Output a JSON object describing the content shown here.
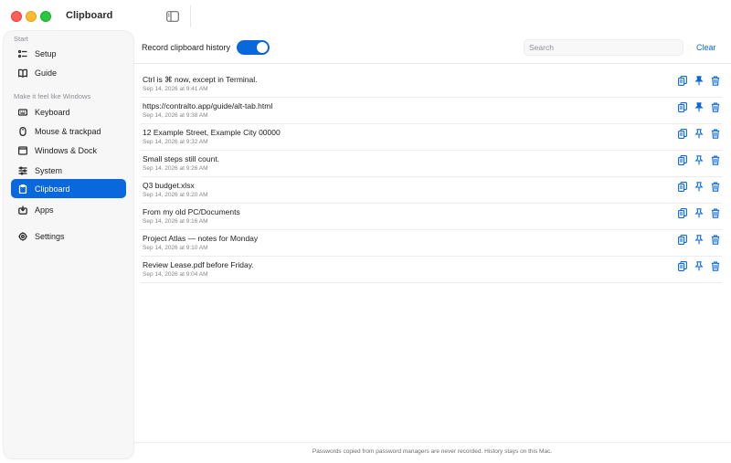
{
  "window": {
    "title": "Clipboard"
  },
  "sidebar": {
    "section_start": "Start",
    "section_windows": "Make it feel like Windows",
    "items": [
      {
        "label": "Setup",
        "icon": "checklist-icon"
      },
      {
        "label": "Guide",
        "icon": "book-icon"
      },
      {
        "label": "Keyboard",
        "icon": "keyboard-icon"
      },
      {
        "label": "Mouse & trackpad",
        "icon": "mouse-icon"
      },
      {
        "label": "Windows & Dock",
        "icon": "windows-icon"
      },
      {
        "label": "System",
        "icon": "sliders-icon"
      },
      {
        "label": "Clipboard",
        "icon": "clipboard-icon",
        "active": true
      },
      {
        "label": "Apps",
        "icon": "apps-icon"
      },
      {
        "label": "Settings",
        "icon": "gear-icon"
      }
    ]
  },
  "toolbar": {
    "record_label": "Record clipboard history",
    "record_enabled": true,
    "search_placeholder": "Search",
    "clear_label": "Clear"
  },
  "clips": [
    {
      "text": "Ctrl is ⌘ now, except in Terminal.",
      "time": "Sep 14, 2026 at 9:41 AM",
      "pinned": true
    },
    {
      "text": "https://contralto.app/guide/alt-tab.html",
      "time": "Sep 14, 2026 at 9:38 AM",
      "pinned": true
    },
    {
      "text": "12 Example Street, Example City 00000",
      "time": "Sep 14, 2026 at 9:32 AM",
      "pinned": false
    },
    {
      "text": "Small steps still count.",
      "time": "Sep 14, 2026 at 9:26 AM",
      "pinned": false
    },
    {
      "text": "Q3 budget.xlsx",
      "time": "Sep 14, 2026 at 9:20 AM",
      "pinned": false
    },
    {
      "text": "From my old PC/Documents",
      "time": "Sep 14, 2026 at 9:16 AM",
      "pinned": false
    },
    {
      "text": "Project Atlas — notes for Monday",
      "time": "Sep 14, 2026 at 9:10 AM",
      "pinned": false
    },
    {
      "text": "Review Lease.pdf before Friday.",
      "time": "Sep 14, 2026 at 9:04 AM",
      "pinned": false
    }
  ],
  "footer": {
    "note": "Passwords copied from password managers are never recorded. History stays on this Mac."
  },
  "colors": {
    "accent": "#0a68dd",
    "sidebar_bg": "#f7f7f8"
  }
}
